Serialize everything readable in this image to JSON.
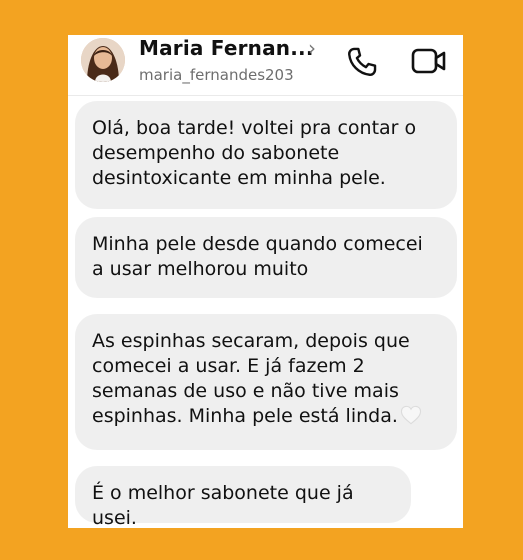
{
  "header": {
    "name": "Maria Fernan...",
    "chevron": "›",
    "handle": "maria_fernandes203",
    "call_icon": "phone-icon",
    "video_icon": "video-camera-icon"
  },
  "messages": [
    {
      "text": "Olá, boa tarde! voltei pra contar o\ndesempenho do sabonete\ndesintoxicante em minha pele."
    },
    {
      "text": "Minha pele desde quando comecei\na usar melhorou muito"
    },
    {
      "text": "As espinhas secaram, depois que\ncomecei a usar. E já fazem 2\nsemanas de uso e não tive mais\nespinhas. Minha pele está linda.",
      "emoji": "white-heart"
    },
    {
      "text": "É o melhor sabonete que já usei."
    }
  ],
  "colors": {
    "background": "#f3a321",
    "card": "#ffffff",
    "bubble": "#efefef"
  }
}
